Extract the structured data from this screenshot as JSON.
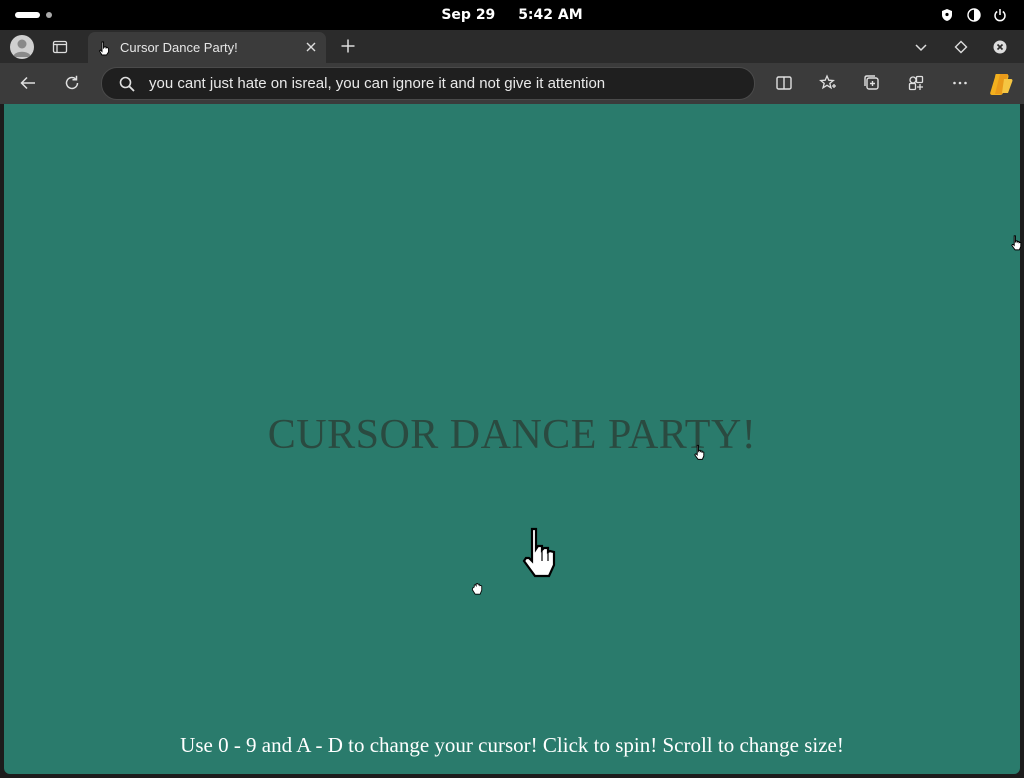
{
  "os": {
    "date": "Sep 29",
    "time": "5:42 AM",
    "icons": [
      "shield-icon",
      "volume-icon",
      "power-icon"
    ]
  },
  "browser": {
    "tab": {
      "title": "Cursor Dance Party!",
      "favicon": "hand-cursor-icon"
    },
    "address_bar": {
      "value": "you cant just hate on isreal, you can ignore it and not give it attention"
    },
    "toolbar_icons": [
      "back-icon",
      "reload-icon",
      "split-screen-icon",
      "favorites-icon",
      "collections-icon",
      "extensions-icon",
      "more-icon",
      "copilot-icon"
    ]
  },
  "page": {
    "background": "#2a7b6c",
    "headline": "CURSOR DANCE PARTY!",
    "instructions": "Use 0 - 9 and A - D to change your cursor! Click to spin! Scroll to change size!",
    "cursor_icon": "hand-pointer-cursor-icon"
  }
}
